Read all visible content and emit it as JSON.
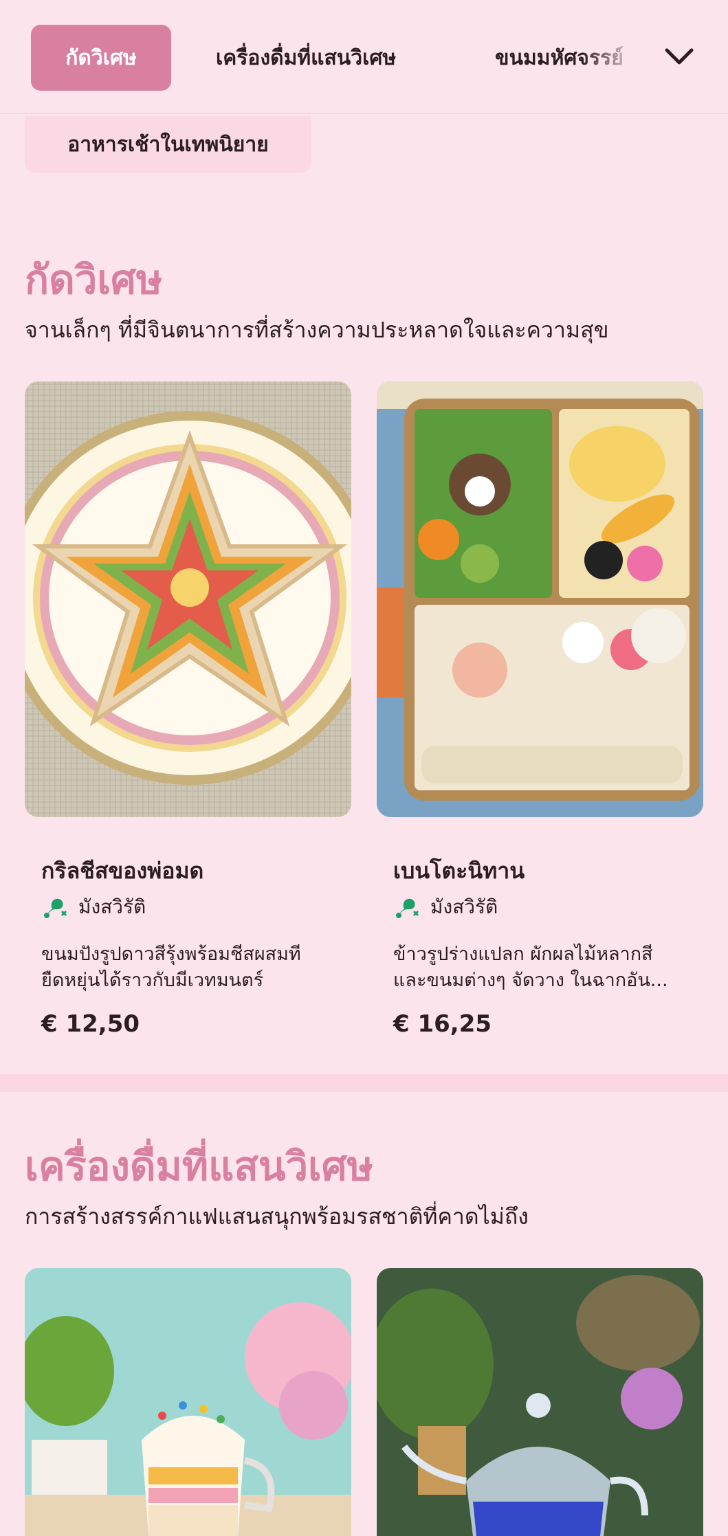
{
  "nav": {
    "tabs": [
      {
        "label": "กัดวิเศษ",
        "active": true
      },
      {
        "label": "เครื่องดื่มที่แสนวิเศษ",
        "active": false
      },
      {
        "label": "ขนมมหัศจรรย์",
        "active": false
      },
      {
        "label": "อาหารเช้าในเทพนิยาย",
        "active": false
      }
    ],
    "expand_icon": "chevron-down-icon"
  },
  "sections": [
    {
      "title": "กัดวิเศษ",
      "subtitle": "จานเล็กๆ ที่มีจินตนาการที่สร้างความประหลาดใจและความสุข",
      "items": [
        {
          "name": "กริลชีสของพ่อมด",
          "tag": "มังสวิรัติ",
          "tag_icon": "no-meat-icon",
          "description": "ขนมปังรูปดาวสีรุ้งพร้อมชีสผสมที ยืดหยุ่นได้ราวกับมีเวทมนตร์",
          "price": "€ 12,50"
        },
        {
          "name": "เบนโตะนิทาน",
          "tag": "มังสวิรัติ",
          "tag_icon": "no-meat-icon",
          "description": "ข้าวรูปร่างแปลก ผักผลไม้หลากสี และขนมต่างๆ จัดวาง ในฉากอัน...",
          "price": "€ 16,25"
        }
      ]
    },
    {
      "title": "เครื่องดื่มที่แสนวิเศษ",
      "subtitle": "การสร้างสรรค์กาแฟแสนสนุกพร้อมรสชาติที่คาดไม่ถึง"
    }
  ],
  "colors": {
    "background": "#fce4ec",
    "accent": "#d97fa0",
    "tag_icon": "#1aa06a"
  }
}
